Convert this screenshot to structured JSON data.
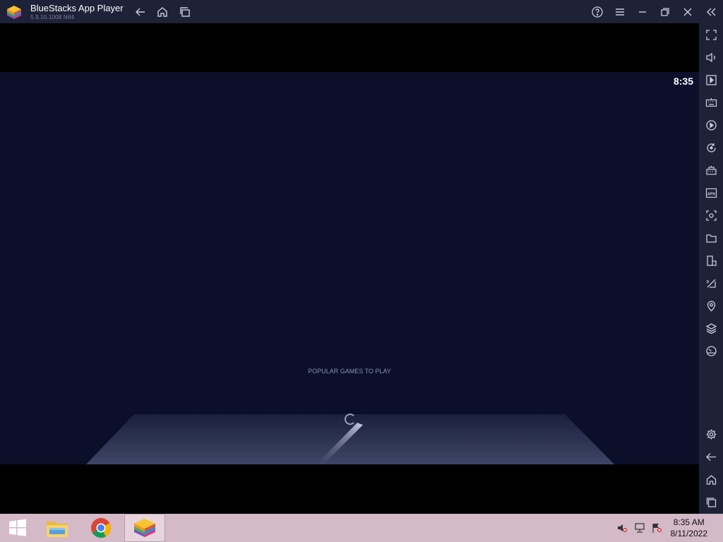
{
  "window": {
    "title": "BlueStacks App Player",
    "version": "5.9.10.1008  N64"
  },
  "titlebar_icons": [
    "back-arrow-icon",
    "home-icon",
    "multi-instance-icon",
    "help-icon",
    "menu-icon",
    "minimize-icon",
    "restore-icon",
    "close-icon",
    "collapse-sidebar-icon"
  ],
  "android": {
    "clock": "8:35",
    "section_label": "POPULAR GAMES TO PLAY"
  },
  "sidebar_icons": [
    "fullscreen-icon",
    "volume-icon",
    "media-manager-icon",
    "keyboard-icon",
    "macro-play-icon",
    "rotate-sync-icon",
    "multi-instance-manager-icon",
    "apk-install-icon",
    "screenshot-icon",
    "folder-icon",
    "device-rotate-icon",
    "eco-mode-icon",
    "location-icon",
    "layers-icon",
    "performance-icon",
    "settings-icon",
    "android-back-icon",
    "android-home-icon",
    "android-recents-icon"
  ],
  "taskbar": {
    "items": [
      "start-button-icon",
      "file-explorer-icon",
      "chrome-icon",
      "bluestacks-icon"
    ],
    "tray": {
      "time": "8:35 AM",
      "date": "8/11/2022"
    }
  },
  "colors": {
    "titlebar": "#1d2238",
    "screen": "#0b0f2a",
    "taskbar": "#d4b9c6"
  }
}
